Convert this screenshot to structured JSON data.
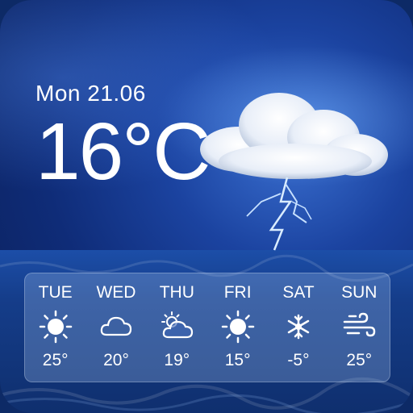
{
  "current": {
    "date": "Mon 21.06",
    "temperature": "16°C",
    "condition_icon": "thunderstorm-icon"
  },
  "forecast": [
    {
      "day": "TUE",
      "temp": "25°",
      "icon": "sun-icon"
    },
    {
      "day": "WED",
      "temp": "20°",
      "icon": "cloud-icon"
    },
    {
      "day": "THU",
      "temp": "19°",
      "icon": "partly-cloudy-icon"
    },
    {
      "day": "FRI",
      "temp": "15°",
      "icon": "sun-icon"
    },
    {
      "day": "SAT",
      "temp": "-5°",
      "icon": "snowflake-icon"
    },
    {
      "day": "SUN",
      "temp": "25°",
      "icon": "wind-icon"
    }
  ],
  "colors": {
    "sky": "#1b43a0",
    "sea": "#153d8a",
    "panel": "#aac8f5",
    "text": "#ffffff"
  }
}
